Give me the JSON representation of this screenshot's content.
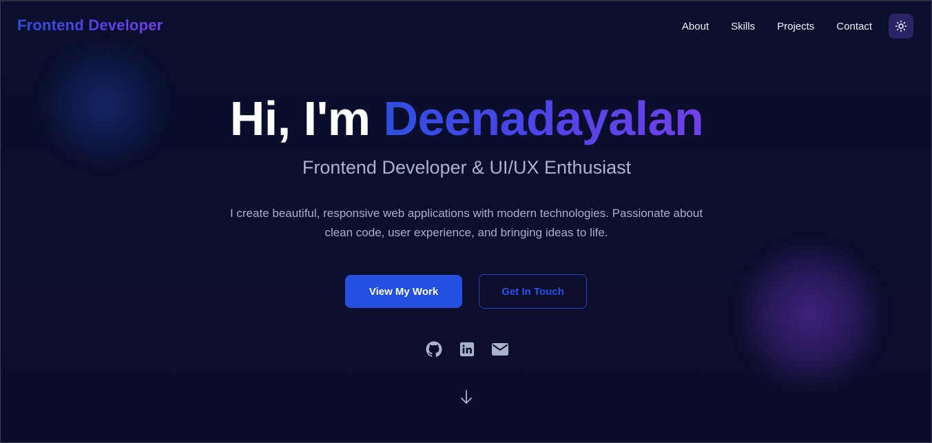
{
  "header": {
    "logo": "Frontend Developer",
    "nav": [
      {
        "label": "About"
      },
      {
        "label": "Skills"
      },
      {
        "label": "Projects"
      },
      {
        "label": "Contact"
      }
    ],
    "theme_toggle_icon": "sun-icon"
  },
  "hero": {
    "greeting": "Hi, I'm",
    "name": "Deenadayalan",
    "subtitle": "Frontend Developer & UI/UX Enthusiast",
    "description": "I create beautiful, responsive web applications with modern technologies. Passionate about clean code, user experience, and bringing ideas to life.",
    "primary_button": "View My Work",
    "secondary_button": "Get In Touch",
    "social_icons": [
      "github-icon",
      "linkedin-icon",
      "mail-icon"
    ],
    "scroll_icon": "arrow-down-icon"
  },
  "colors": {
    "background": "#0b0f2e",
    "accent_blue": "#2350e0",
    "accent_purple": "#7141e8",
    "muted_text": "#a9b4cc"
  }
}
